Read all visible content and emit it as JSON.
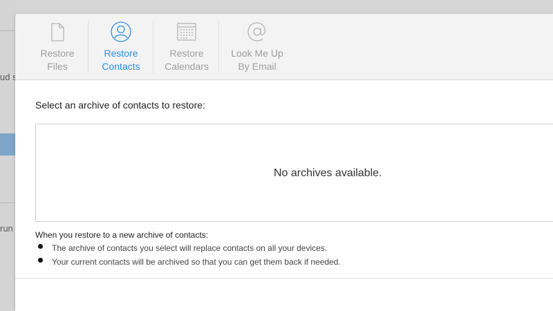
{
  "background": {
    "snippet_1": "ud s",
    "snippet_2": "run"
  },
  "toolbar": {
    "tabs": [
      {
        "line1": "Restore",
        "line2": "Files",
        "icon": "document-icon"
      },
      {
        "line1": "Restore",
        "line2": "Contacts",
        "icon": "contact-icon"
      },
      {
        "line1": "Restore",
        "line2": "Calendars",
        "icon": "calendar-icon"
      },
      {
        "line1": "Look Me Up",
        "line2": "By Email",
        "icon": "at-icon"
      }
    ],
    "active_tab": "Restore Contacts"
  },
  "content": {
    "heading": "Select an archive of contacts to restore:",
    "empty_message": "No archives available.",
    "info_heading": "When you restore to a new archive of contacts:",
    "bullets": [
      "The archive of contacts you select will replace contacts on all your devices.",
      "Your current contacts will be archived so that you can get them back if needed."
    ]
  },
  "colors": {
    "accent": "#2a8fe0",
    "inactive": "#9e9e9e"
  }
}
